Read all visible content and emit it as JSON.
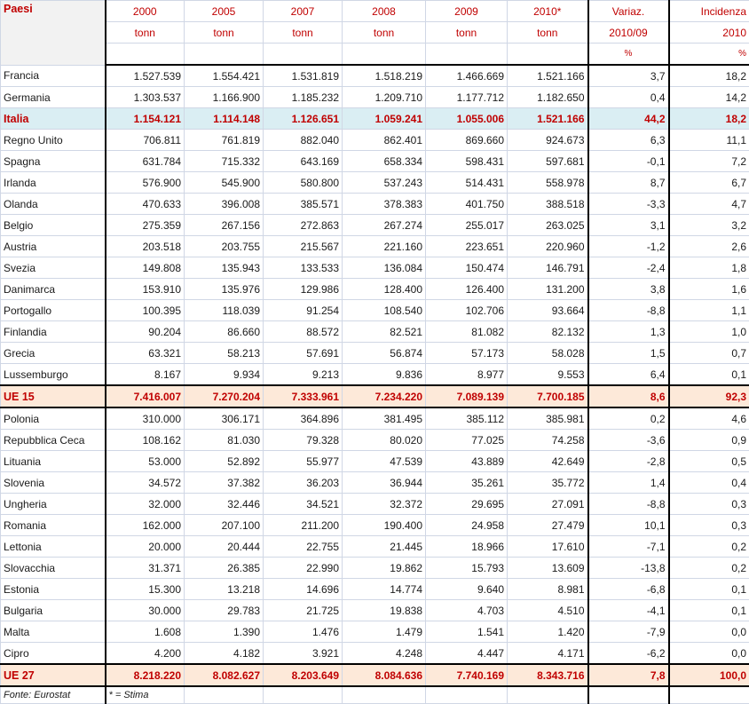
{
  "table": {
    "header": {
      "country_label": "Paesi",
      "year_columns": [
        {
          "year": "2000",
          "unit": "tonn"
        },
        {
          "year": "2005",
          "unit": "tonn"
        },
        {
          "year": "2007",
          "unit": "tonn"
        },
        {
          "year": "2008",
          "unit": "tonn"
        },
        {
          "year": "2009",
          "unit": "tonn"
        },
        {
          "year": "2010*",
          "unit": "tonn"
        }
      ],
      "variation": {
        "line1": "Variaz.",
        "line2": "2010/09",
        "unit": "%"
      },
      "incidence": {
        "line1": "Incidenza",
        "line2": "2010",
        "unit": "%"
      }
    },
    "rows": [
      {
        "country": "Francia",
        "values": [
          "1.527.539",
          "1.554.421",
          "1.531.819",
          "1.518.219",
          "1.466.669",
          "1.521.166"
        ],
        "variation": "3,7",
        "incidence": "18,2",
        "style": "normal"
      },
      {
        "country": "Germania",
        "values": [
          "1.303.537",
          "1.166.900",
          "1.185.232",
          "1.209.710",
          "1.177.712",
          "1.182.650"
        ],
        "variation": "0,4",
        "incidence": "14,2",
        "style": "normal"
      },
      {
        "country": "Italia",
        "values": [
          "1.154.121",
          "1.114.148",
          "1.126.651",
          "1.059.241",
          "1.055.006",
          "1.521.166"
        ],
        "variation": "44,2",
        "incidence": "18,2",
        "style": "highlight"
      },
      {
        "country": "Regno Unito",
        "values": [
          "706.811",
          "761.819",
          "882.040",
          "862.401",
          "869.660",
          "924.673"
        ],
        "variation": "6,3",
        "incidence": "11,1",
        "style": "normal"
      },
      {
        "country": "Spagna",
        "values": [
          "631.784",
          "715.332",
          "643.169",
          "658.334",
          "598.431",
          "597.681"
        ],
        "variation": "-0,1",
        "incidence": "7,2",
        "style": "normal"
      },
      {
        "country": "Irlanda",
        "values": [
          "576.900",
          "545.900",
          "580.800",
          "537.243",
          "514.431",
          "558.978"
        ],
        "variation": "8,7",
        "incidence": "6,7",
        "style": "normal"
      },
      {
        "country": "Olanda",
        "values": [
          "470.633",
          "396.008",
          "385.571",
          "378.383",
          "401.750",
          "388.518"
        ],
        "variation": "-3,3",
        "incidence": "4,7",
        "style": "normal"
      },
      {
        "country": "Belgio",
        "values": [
          "275.359",
          "267.156",
          "272.863",
          "267.274",
          "255.017",
          "263.025"
        ],
        "variation": "3,1",
        "incidence": "3,2",
        "style": "normal"
      },
      {
        "country": "Austria",
        "values": [
          "203.518",
          "203.755",
          "215.567",
          "221.160",
          "223.651",
          "220.960"
        ],
        "variation": "-1,2",
        "incidence": "2,6",
        "style": "normal"
      },
      {
        "country": "Svezia",
        "values": [
          "149.808",
          "135.943",
          "133.533",
          "136.084",
          "150.474",
          "146.791"
        ],
        "variation": "-2,4",
        "incidence": "1,8",
        "style": "normal"
      },
      {
        "country": "Danimarca",
        "values": [
          "153.910",
          "135.976",
          "129.986",
          "128.400",
          "126.400",
          "131.200"
        ],
        "variation": "3,8",
        "incidence": "1,6",
        "style": "normal"
      },
      {
        "country": "Portogallo",
        "values": [
          "100.395",
          "118.039",
          "91.254",
          "108.540",
          "102.706",
          "93.664"
        ],
        "variation": "-8,8",
        "incidence": "1,1",
        "style": "normal"
      },
      {
        "country": "Finlandia",
        "values": [
          "90.204",
          "86.660",
          "88.572",
          "82.521",
          "81.082",
          "82.132"
        ],
        "variation": "1,3",
        "incidence": "1,0",
        "style": "normal"
      },
      {
        "country": "Grecia",
        "values": [
          "63.321",
          "58.213",
          "57.691",
          "56.874",
          "57.173",
          "58.028"
        ],
        "variation": "1,5",
        "incidence": "0,7",
        "style": "normal"
      },
      {
        "country": "Lussemburgo",
        "values": [
          "8.167",
          "9.934",
          "9.213",
          "9.836",
          "8.977",
          "9.553"
        ],
        "variation": "6,4",
        "incidence": "0,1",
        "style": "normal"
      },
      {
        "country": "UE 15",
        "values": [
          "7.416.007",
          "7.270.204",
          "7.333.961",
          "7.234.220",
          "7.089.139",
          "7.700.185"
        ],
        "variation": "8,6",
        "incidence": "92,3",
        "style": "total"
      },
      {
        "country": "Polonia",
        "values": [
          "310.000",
          "306.171",
          "364.896",
          "381.495",
          "385.112",
          "385.981"
        ],
        "variation": "0,2",
        "incidence": "4,6",
        "style": "normal"
      },
      {
        "country": "Repubblica Ceca",
        "values": [
          "108.162",
          "81.030",
          "79.328",
          "80.020",
          "77.025",
          "74.258"
        ],
        "variation": "-3,6",
        "incidence": "0,9",
        "style": "normal"
      },
      {
        "country": "Lituania",
        "values": [
          "53.000",
          "52.892",
          "55.977",
          "47.539",
          "43.889",
          "42.649"
        ],
        "variation": "-2,8",
        "incidence": "0,5",
        "style": "normal"
      },
      {
        "country": "Slovenia",
        "values": [
          "34.572",
          "37.382",
          "36.203",
          "36.944",
          "35.261",
          "35.772"
        ],
        "variation": "1,4",
        "incidence": "0,4",
        "style": "normal"
      },
      {
        "country": "Ungheria",
        "values": [
          "32.000",
          "32.446",
          "34.521",
          "32.372",
          "29.695",
          "27.091"
        ],
        "variation": "-8,8",
        "incidence": "0,3",
        "style": "normal"
      },
      {
        "country": "Romania",
        "values": [
          "162.000",
          "207.100",
          "211.200",
          "190.400",
          "24.958",
          "27.479"
        ],
        "variation": "10,1",
        "incidence": "0,3",
        "style": "normal"
      },
      {
        "country": "Lettonia",
        "values": [
          "20.000",
          "20.444",
          "22.755",
          "21.445",
          "18.966",
          "17.610"
        ],
        "variation": "-7,1",
        "incidence": "0,2",
        "style": "normal"
      },
      {
        "country": "Slovacchia",
        "values": [
          "31.371",
          "26.385",
          "22.990",
          "19.862",
          "15.793",
          "13.609"
        ],
        "variation": "-13,8",
        "incidence": "0,2",
        "style": "normal"
      },
      {
        "country": "Estonia",
        "values": [
          "15.300",
          "13.218",
          "14.696",
          "14.774",
          "9.640",
          "8.981"
        ],
        "variation": "-6,8",
        "incidence": "0,1",
        "style": "normal"
      },
      {
        "country": "Bulgaria",
        "values": [
          "30.000",
          "29.783",
          "21.725",
          "19.838",
          "4.703",
          "4.510"
        ],
        "variation": "-4,1",
        "incidence": "0,1",
        "style": "normal"
      },
      {
        "country": "Malta",
        "values": [
          "1.608",
          "1.390",
          "1.476",
          "1.479",
          "1.541",
          "1.420"
        ],
        "variation": "-7,9",
        "incidence": "0,0",
        "style": "normal"
      },
      {
        "country": "Cipro",
        "values": [
          "4.200",
          "4.182",
          "3.921",
          "4.248",
          "4.447",
          "4.171"
        ],
        "variation": "-6,2",
        "incidence": "0,0",
        "style": "normal"
      },
      {
        "country": "UE 27",
        "values": [
          "8.218.220",
          "8.082.627",
          "8.203.649",
          "8.084.636",
          "7.740.169",
          "8.343.716"
        ],
        "variation": "7,8",
        "incidence": "100,0",
        "style": "total"
      }
    ],
    "footer": {
      "source": "Fonte: Eurostat",
      "note": "* = Stima"
    }
  }
}
